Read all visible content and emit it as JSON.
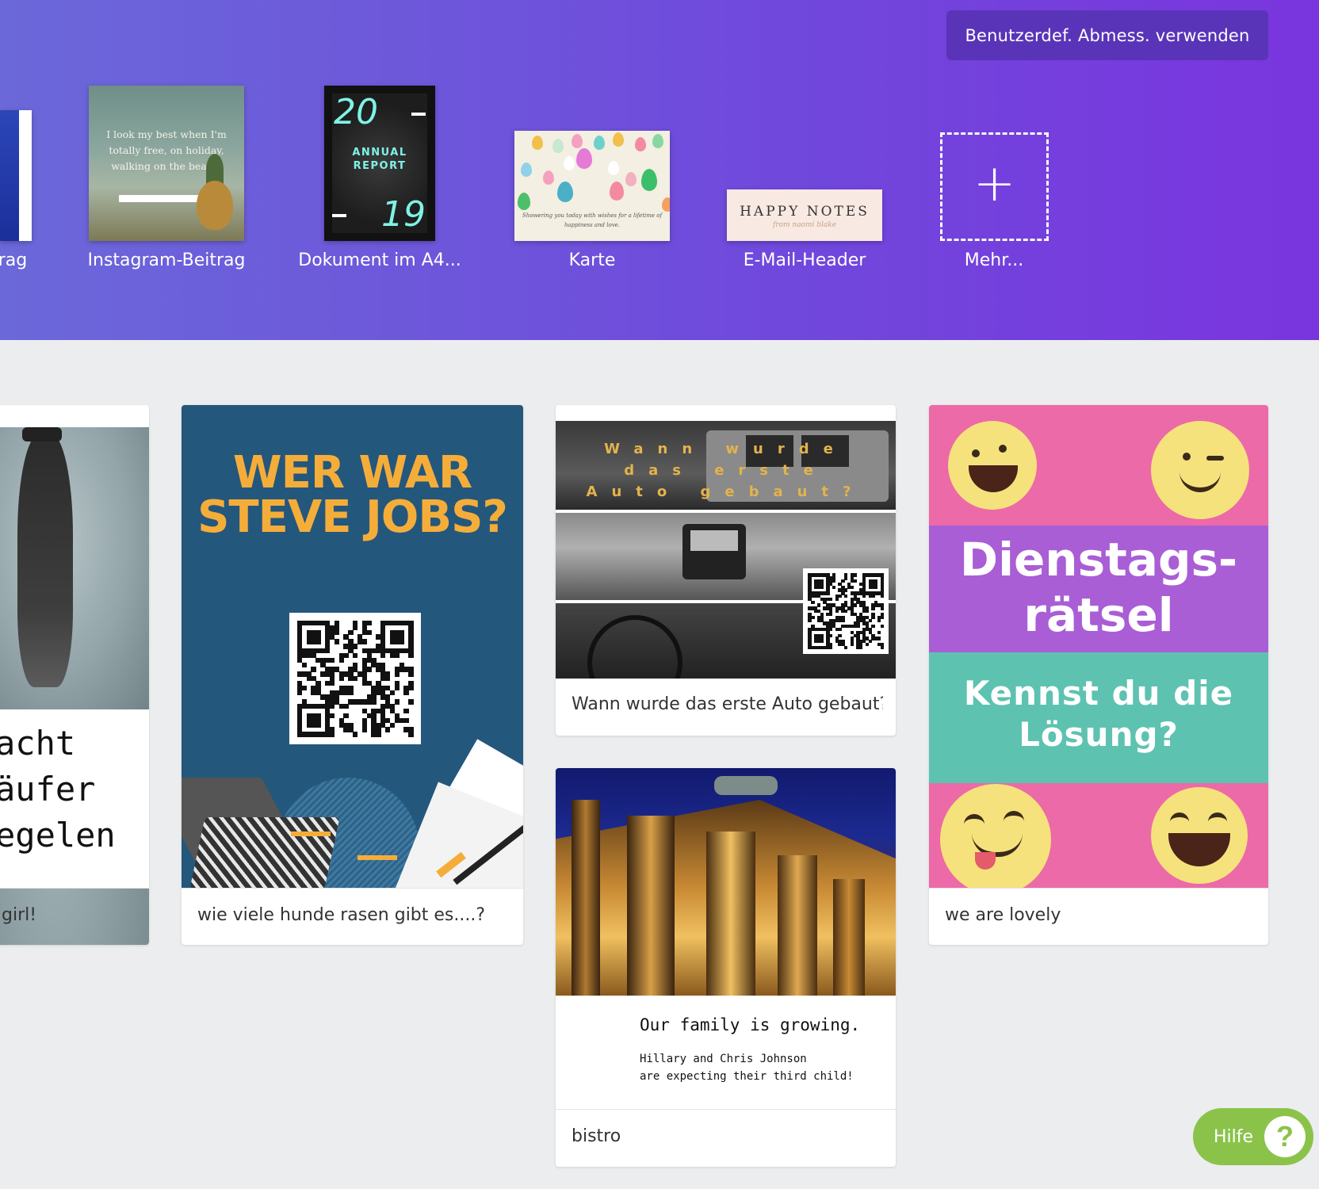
{
  "hero": {
    "custom_size_button": "Benutzerdef. Abmess. verwenden",
    "templates": [
      {
        "label": "rag"
      },
      {
        "label": "Instagram-Beitrag",
        "thumb_text": "I look my best when I'm totally free, on holiday, walking on the beach."
      },
      {
        "label": "Dokument im A4...",
        "thumb_year_top": "20",
        "thumb_year_bottom": "19",
        "thumb_title": "ANNUAL REPORT"
      },
      {
        "label": "Karte",
        "thumb_text": "Showering you today with wishes for a lifetime of happiness and love."
      },
      {
        "label": "E-Mail-Header",
        "thumb_title": "HAPPY NOTES",
        "thumb_sub": "from naomi blake"
      },
      {
        "label": "Mehr..."
      }
    ],
    "colors": {
      "gradient_start": "#6b68d9",
      "gradient_end": "#7a35de",
      "button_bg": "#5a34b8"
    }
  },
  "cards": [
    {
      "caption": "girl!",
      "lines": [
        "acht",
        "äufer",
        "egelen"
      ]
    },
    {
      "caption": "wie viele hunde rasen gibt es....?",
      "headline": "WER WAR STEVE JOBS?"
    },
    {
      "caption": "Wann wurde das erste Auto gebaut?",
      "title_lines": [
        "Wann wurde",
        "das erste",
        "Auto gebaut?"
      ]
    },
    {
      "caption": "bistro",
      "invite_title": "Our family is growing.",
      "invite_lines": [
        "Hillary and Chris Johnson",
        "are expecting their third child!"
      ]
    },
    {
      "caption": "we are lovely",
      "headline_lines": [
        "Dienstags-",
        "rätsel"
      ],
      "sub_lines": [
        "Kennst du die",
        "Lösung?"
      ]
    }
  ],
  "help": {
    "label": "Hilfe",
    "icon": "question-icon",
    "color": "#8bc34a"
  }
}
